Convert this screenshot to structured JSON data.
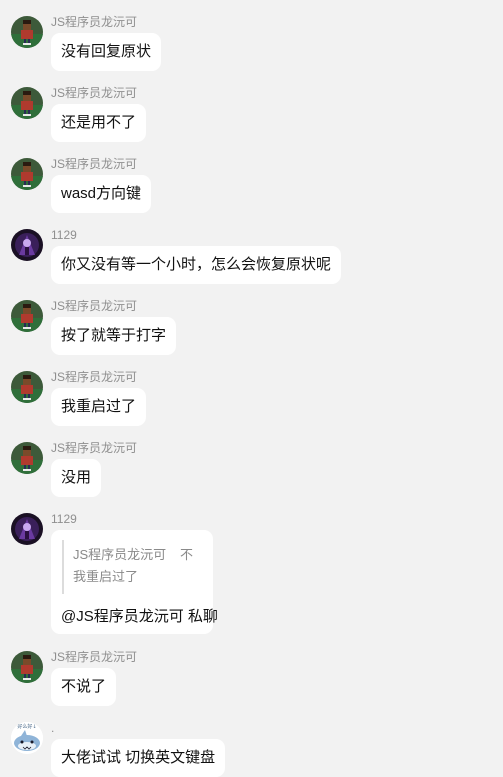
{
  "messages": [
    {
      "sender": "JS程序员龙沅可",
      "text": "没有回复原状"
    },
    {
      "sender": "JS程序员龙沅可",
      "text": "还是用不了"
    },
    {
      "sender": "JS程序员龙沅可",
      "text": "wasd方向键"
    },
    {
      "sender": "1129",
      "text": "你又没有等一个小时，怎么会恢复原状呢"
    },
    {
      "sender": "JS程序员龙沅可",
      "text": "按了就等于打字"
    },
    {
      "sender": "JS程序员龙沅可",
      "text": "我重启过了"
    },
    {
      "sender": "JS程序员龙沅可",
      "text": "没用"
    },
    {
      "sender": "1129",
      "quote": {
        "author": "JS程序员龙沅可",
        "more": "不",
        "text": "我重启过了"
      },
      "text": "@JS程序员龙沅可 私聊"
    },
    {
      "sender": "JS程序员龙沅可",
      "text": "不说了"
    },
    {
      "sender": ".",
      "avatar_caption": "好么好↓",
      "text": "大佬试试 切换英文键盘"
    }
  ],
  "colors": {
    "background": "#f2f2f2",
    "bubble": "#ffffff",
    "sender_text": "#8f8f8f",
    "message_text": "#111111"
  }
}
